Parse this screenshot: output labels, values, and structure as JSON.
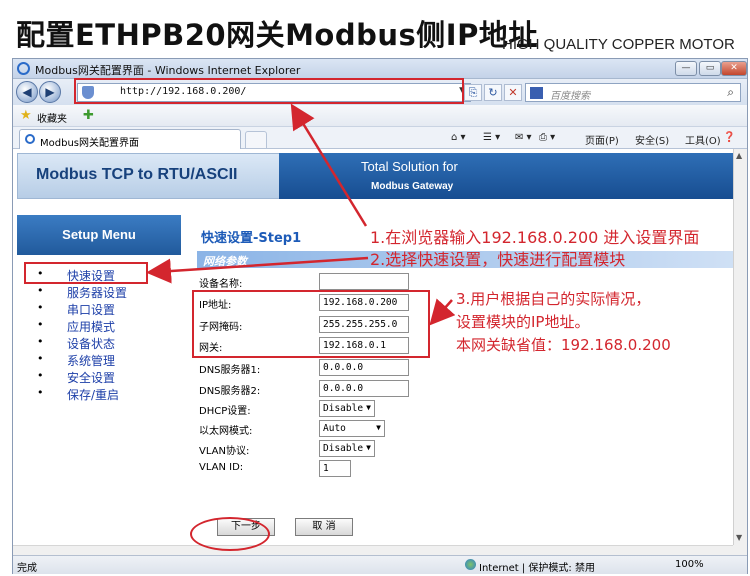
{
  "slide": {
    "title": "配置ETHPB20网关Modbus侧IP地址",
    "watermark": "HIGH QUALITY COPPER MOTOR"
  },
  "browser": {
    "window_title": "Modbus网关配置界面 - Windows Internet Explorer",
    "url": "http://192.168.0.200/",
    "search_placeholder": "百度搜索",
    "favorites_label": "收藏夹",
    "tab_label": "Modbus网关配置界面",
    "command_bar": {
      "page": "页面(P)",
      "safety": "安全(S)",
      "tools": "工具(O)"
    },
    "status": {
      "done": "完成",
      "zone": "Internet | 保护模式: 禁用",
      "zoom": "100%"
    }
  },
  "page": {
    "banner": {
      "product": "Modbus TCP to RTU/ASCII",
      "tagline": "Total Solution for",
      "subtitle": "Modbus Gateway"
    },
    "sidebar": {
      "heading": "Setup Menu",
      "items": [
        "快速设置",
        "服务器设置",
        "串口设置",
        "应用模式",
        "设备状态",
        "系统管理",
        "安全设置",
        "保存/重启"
      ]
    },
    "main": {
      "step_title": "快速设置-Step1",
      "section": "网络参数",
      "fields": [
        {
          "label": "设备名称:",
          "value": ""
        },
        {
          "label": "IP地址:",
          "value": "192.168.0.200"
        },
        {
          "label": "子网掩码:",
          "value": "255.255.255.0"
        },
        {
          "label": "网关:",
          "value": "192.168.0.1"
        },
        {
          "label": "DNS服务器1:",
          "value": "0.0.0.0"
        },
        {
          "label": "DNS服务器2:",
          "value": "0.0.0.0"
        }
      ],
      "selects": [
        {
          "label": "DHCP设置:",
          "value": "Disable"
        },
        {
          "label": "以太网模式:",
          "value": "Auto"
        },
        {
          "label": "VLAN协议:",
          "value": "Disable"
        }
      ],
      "vlan_id": {
        "label": "VLAN ID:",
        "value": "1"
      },
      "buttons": {
        "next": "下一步",
        "cancel": "取 消"
      }
    }
  },
  "annotations": {
    "step1": "1.在浏览器输入192.168.0.200 进入设置界面",
    "step2": "2.选择快速设置，快速进行配置模块",
    "step3_line1": "3.用户根据自己的实际情况，",
    "step3_line2": "设置模块的IP地址。",
    "step3_line3": "本网关缺省值：192.168.0.200"
  },
  "colors": {
    "annotation_red": "#d3262e",
    "banner_blue": "#174d91",
    "menu_link": "#1d3fa8"
  }
}
